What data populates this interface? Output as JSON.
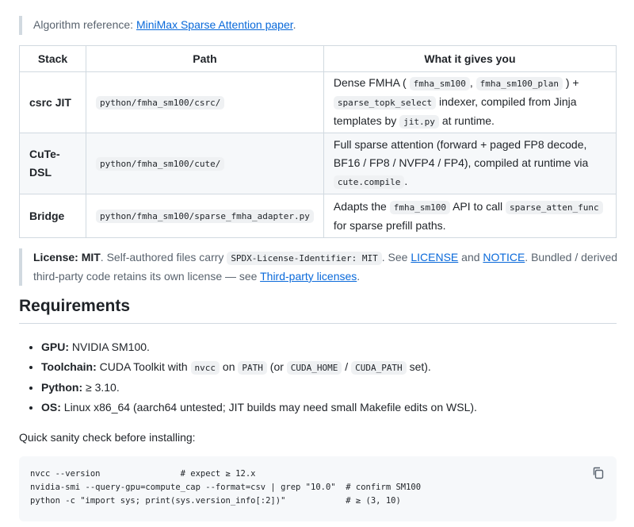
{
  "algo_quote": {
    "prefix": "Algorithm reference: ",
    "link": "MiniMax Sparse Attention paper",
    "suffix": "."
  },
  "table": {
    "headers": [
      "Stack",
      "Path",
      "What it gives you"
    ],
    "rows": [
      {
        "stack": "csrc JIT",
        "path": "python/fmha_sm100/csrc/",
        "desc": {
          "t1": "Dense FMHA (",
          "c1": "fmha_sm100",
          "t2": ",",
          "c2": "fmha_sm100_plan",
          "t3": ") +",
          "c3": "sparse_topk_select",
          "t4": "indexer, compiled from Jinja templates by",
          "c4": "jit.py",
          "t5": "at runtime."
        }
      },
      {
        "stack": "CuTe-DSL",
        "path": "python/fmha_sm100/cute/",
        "desc": {
          "t1": "Full sparse attention (forward + paged FP8 decode, BF16 / FP8 / NVFP4 / FP4), compiled at runtime via",
          "c1": "cute.compile",
          "t2": "."
        }
      },
      {
        "stack": "Bridge",
        "path": "python/fmha_sm100/sparse_fmha_adapter.py",
        "desc": {
          "t1": "Adapts the",
          "c1": "fmha_sm100",
          "t2": "API to call",
          "c2": "sparse_atten_func",
          "t3": "for sparse prefill paths."
        }
      }
    ]
  },
  "license_quote": {
    "label": "License: MIT",
    "t1": ". Self-authored files carry",
    "code": "SPDX-License-Identifier: MIT",
    "t2": ". See",
    "link1": "LICENSE",
    "t3": "and",
    "link2": "NOTICE",
    "t4": ". Bundled / derived third-party code retains its own license — see",
    "link3": "Third-party licenses",
    "t5": "."
  },
  "requirements": {
    "title": "Requirements",
    "items": [
      {
        "label": "GPU:",
        "text": "NVIDIA SM100."
      },
      {
        "label": "Toolchain:",
        "t1": "CUDA Toolkit with",
        "c1": "nvcc",
        "t2": "on",
        "c2": "PATH",
        "t3": "(or",
        "c3": "CUDA_HOME",
        "t4": "/",
        "c4": "CUDA_PATH",
        "t5": "set)."
      },
      {
        "label": "Python:",
        "text": "≥ 3.10."
      },
      {
        "label": "OS:",
        "text": "Linux x86_64 (aarch64 untested; JIT builds may need small Makefile edits on WSL)."
      }
    ],
    "sanity_text": "Quick sanity check before installing:"
  },
  "code": {
    "lines": [
      "nvcc --version                # expect ≥ 12.x",
      "nvidia-smi --query-gpu=compute_cap --format=csv | grep \"10.0\"  # confirm SM100",
      "python -c \"import sys; print(sys.version_info[:2])\"            # ≥ (3, 10)"
    ],
    "copy_icon": "copy-icon"
  }
}
